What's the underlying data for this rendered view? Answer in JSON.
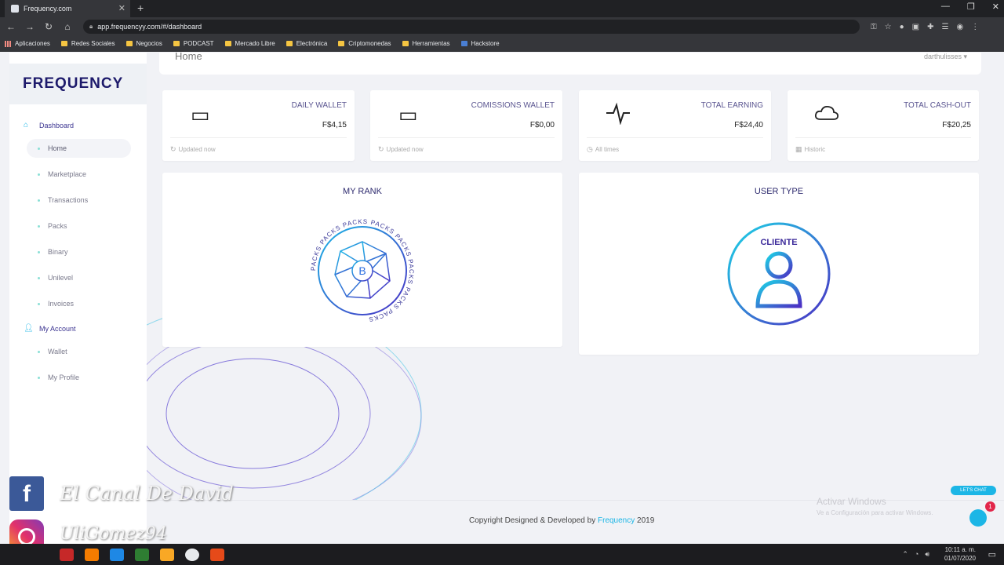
{
  "browser": {
    "tab_title": "Frequency.com",
    "url": "app.frequencyy.com/#/dashboard",
    "bookmarks": [
      "Aplicaciones",
      "Redes Sociales",
      "Negocios",
      "PODCAST",
      "Mercado Libre",
      "Electrónica",
      "Criptomonedas",
      "Herramientas",
      "Hackstore"
    ]
  },
  "header": {
    "page_title": "Home",
    "username": "darthulisses ▾"
  },
  "brand": {
    "logo_text": "FREQUENCY",
    "accent_color": "#1cb6e6",
    "primary_color": "#2d2a6e"
  },
  "sidebar": {
    "section_dashboard": "Dashboard",
    "items": [
      "Home",
      "Marketplace",
      "Transactions",
      "Packs",
      "Binary",
      "Unilevel",
      "Invoices"
    ],
    "section_account": "My Account",
    "account_items": [
      "Wallet",
      "My Profile"
    ]
  },
  "stats": [
    {
      "icon": "wallet-icon",
      "label": "DAILY WALLET",
      "value": "F$4,15",
      "footer": "Updated now"
    },
    {
      "icon": "wallet-icon",
      "label": "COMISSIONS WALLET",
      "value": "F$0,00",
      "footer": "Updated now"
    },
    {
      "icon": "pulse-icon",
      "label": "TOTAL EARNING",
      "value": "F$24,40",
      "footer": "All times"
    },
    {
      "icon": "cloud-icon",
      "label": "TOTAL CASH-OUT",
      "value": "F$20,25",
      "footer": "Historic"
    }
  ],
  "rank": {
    "title": "MY RANK",
    "badge_text": "PACKS",
    "center_letter": "B"
  },
  "usertype": {
    "title": "USER TYPE",
    "badge_text": "CLIENTE"
  },
  "footer": {
    "prefix": "Copyright Designed & Developed by",
    "brand": "Frequency",
    "year": "2019"
  },
  "windows": {
    "activate_title": "Activar Windows",
    "activate_sub": "Ve a Configuración para activar Windows.",
    "time": "10:11 a. m.",
    "date": "01/07/2020"
  },
  "chat": {
    "badge": "1",
    "bubble": "LET'S CHAT"
  },
  "overlay": {
    "line1": "El Canal De David",
    "line2": "UliGomez94"
  }
}
